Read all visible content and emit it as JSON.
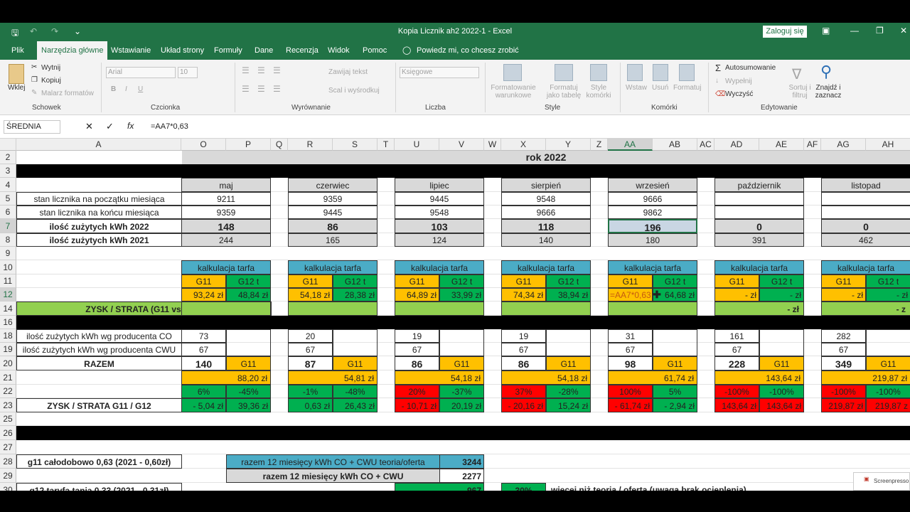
{
  "app": {
    "title": "Kopia Licznik ah2 2022-1  -  Excel",
    "login": "Zaloguj się"
  },
  "tabs": [
    "Plik",
    "Narzędzia główne",
    "Wstawianie",
    "Układ strony",
    "Formuły",
    "Dane",
    "Recenzja",
    "Widok",
    "Pomoc",
    "Powiedz mi, co chcesz zrobić"
  ],
  "ribbon": {
    "clipboard": {
      "paste": "Wklej",
      "cut": "Wytnij",
      "copy": "Kopiuj",
      "painter": "Malarz formatów",
      "group": "Schowek"
    },
    "font": {
      "name": "Arial",
      "size": "10",
      "bold": "B",
      "italic": "I",
      "underline": "U",
      "group": "Czcionka"
    },
    "align": {
      "wrap": "Zawijaj tekst",
      "merge": "Scal i wyśrodkuj",
      "group": "Wyrównanie"
    },
    "number": {
      "format": "Księgowe",
      "group": "Liczba"
    },
    "styles": {
      "cond": "Formatowanie warunkowe",
      "table": "Formatuj jako tabelę",
      "cell": "Style komórki",
      "group": "Style"
    },
    "cells": {
      "insert": "Wstaw",
      "delete": "Usuń",
      "format": "Formatuj",
      "group": "Komórki"
    },
    "editing": {
      "autosum": "Autosumowanie",
      "fill": "Wypełnij",
      "clear": "Wyczyść",
      "sort": "Sortuj i filtruj",
      "find": "Znajdź i zaznacz",
      "group": "Edytowanie"
    }
  },
  "formula_bar": {
    "name_box": "ŚREDNIA",
    "formula": "=AA7*0,63"
  },
  "columns": [
    "A",
    "O",
    "P",
    "Q",
    "R",
    "S",
    "T",
    "U",
    "V",
    "W",
    "X",
    "Y",
    "Z",
    "AA",
    "AB",
    "AC",
    "AD",
    "AE",
    "AF",
    "AG",
    "AH"
  ],
  "rows": [
    "2",
    "3",
    "4",
    "5",
    "6",
    "7",
    "8",
    "9",
    "10",
    "11",
    "12",
    "14",
    "16",
    "18",
    "19",
    "20",
    "21",
    "22",
    "23",
    "25",
    "26",
    "27",
    "28",
    "29",
    "30"
  ],
  "sheet": {
    "year": "rok 2022",
    "labels": {
      "r5": "stan licznika na początku miesiąca",
      "r6": "stan licznika na końcu miesiąca",
      "r7": "ilość zużytych kWh 2022",
      "r8": "ilość zużytych kWh 2021",
      "r14": "ZYSK / STRATA (G11 vs G12)",
      "r18": "ilość zużytych kWh wg producenta CO",
      "r19": "ilość zużytych kWh wg producenta CWU",
      "r20": "RAZEM",
      "r23": "ZYSK / STRATA  G11 / G12",
      "r28": "g11 całodobowo 0,63 (2021 - 0,60zł)",
      "r30": "g12 taryfa tania 0,33 (2021 - 0,31zł)"
    },
    "months": [
      {
        "name": "maj",
        "r5": "9211",
        "r6": "9359",
        "r7": "148",
        "r8": "244",
        "calc": "kalkulacja tarfa",
        "g11": "G11",
        "g12": "G12 t",
        "g11v": "93,24 zł",
        "g12v": "48,84 zł",
        "r14": "",
        "r18": "73",
        "r19": "67",
        "r20": "140",
        "r20b": "G11",
        "r21": "88,20 zł",
        "r22a": "6%",
        "r22b": "-45%",
        "r23a": "-      5,04 zł",
        "r23b": "39,36 zł"
      },
      {
        "name": "czerwiec",
        "r5": "9359",
        "r6": "9445",
        "r7": "86",
        "r8": "165",
        "calc": "kalkulacja tarfa",
        "g11": "G11",
        "g12": "G12 t",
        "g11v": "54,18 zł",
        "g12v": "28,38 zł",
        "r14": "",
        "r18": "20",
        "r19": "67",
        "r20": "87",
        "r20b": "G11",
        "r21": "54,81 zł",
        "r22a": "-1%",
        "r22b": "-48%",
        "r23a": "0,63 zł",
        "r23b": "26,43 zł"
      },
      {
        "name": "lipiec",
        "r5": "9445",
        "r6": "9548",
        "r7": "103",
        "r8": "124",
        "calc": "kalkulacja tarfa",
        "g11": "G11",
        "g12": "G12 t",
        "g11v": "64,89 zł",
        "g12v": "33,99 zł",
        "r14": "",
        "r18": "19",
        "r19": "67",
        "r20": "86",
        "r20b": "G11",
        "r21": "54,18 zł",
        "r22a": "20%",
        "r22b": "-37%",
        "r23a": "-    10,71 zł",
        "r23b": "20,19 zł"
      },
      {
        "name": "sierpień",
        "r5": "9548",
        "r6": "9666",
        "r7": "118",
        "r8": "140",
        "calc": "kalkulacja tarfa",
        "g11": "G11",
        "g12": "G12 t",
        "g11v": "74,34 zł",
        "g12v": "38,94 zł",
        "r14": "",
        "r18": "19",
        "r19": "67",
        "r20": "86",
        "r20b": "G11",
        "r21": "54,18 zł",
        "r22a": "37%",
        "r22b": "-28%",
        "r23a": "-    20,16 zł",
        "r23b": "15,24 zł"
      },
      {
        "name": "wrzesień",
        "r5": "9666",
        "r6": "9862",
        "r7": "196",
        "r8": "180",
        "calc": "kalkulacja tarfa",
        "g11": "G11",
        "g12": "G12 t",
        "g11v": "=AA7*0,63",
        "g12v": "64,68 zł",
        "r14": "",
        "r18": "31",
        "r19": "67",
        "r20": "98",
        "r20b": "G11",
        "r21": "61,74 zł",
        "r22a": "100%",
        "r22b": "5%",
        "r23a": "-    61,74 zł",
        "r23b": "-      2,94 zł"
      },
      {
        "name": "październik",
        "r5": "",
        "r6": "",
        "r7": "0",
        "r8": "391",
        "calc": "kalkulacja tarfa",
        "g11": "G11",
        "g12": "G12 t",
        "g11v": "-     zł",
        "g12v": "-     zł",
        "r14": "-     zł",
        "r18": "161",
        "r19": "67",
        "r20": "228",
        "r20b": "G11",
        "r21": "143,64 zł",
        "r22a": "-100%",
        "r22b": "-100%",
        "r23a": "143,64 zł",
        "r23b": "143,64 zł"
      },
      {
        "name": "listopad",
        "r5": "",
        "r6": "",
        "r7": "0",
        "r8": "462",
        "calc": "kalkulacja tarfa",
        "g11": "G11",
        "g12": "G12 t",
        "g11v": "-     zł",
        "g12v": "-     zł",
        "r14": "-     z",
        "r18": "282",
        "r19": "67",
        "r20": "349",
        "r20b": "G11",
        "r21": "219,87 zł",
        "r22a": "-100%",
        "r22b": "-100%",
        "r23a": "219,87 zł",
        "r23b": "219,87 z"
      }
    ],
    "summary": {
      "r28_label": "razem 12 miesięcy kWh CO + CWU teoria/oferta",
      "r28_val": "3244",
      "r29_label": "razem 12 miesięcy kWh CO + CWU",
      "r29_val": "2277",
      "r30_val": "967",
      "r30_pct": "30%",
      "r30_note": "więcej niż teoria / oferta (uwaga brak ocieplenia)"
    }
  },
  "watermark": "Screenpresso"
}
